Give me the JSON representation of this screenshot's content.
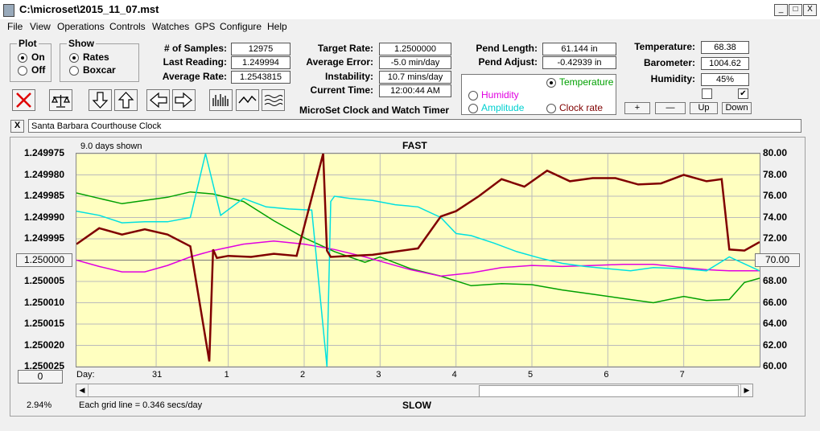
{
  "window": {
    "title": "C:\\microset\\2015_11_07.mst",
    "min": "_",
    "max": "□",
    "close": "X"
  },
  "menu": [
    "File",
    "View",
    "Operations",
    "Controls",
    "Watches",
    "GPS",
    "Configure",
    "Help"
  ],
  "plot": {
    "legend": "Plot",
    "on": "On",
    "off": "Off",
    "selected": "On"
  },
  "show": {
    "legend": "Show",
    "rates": "Rates",
    "boxcar": "Boxcar",
    "selected": "Rates"
  },
  "stats": {
    "samples_label": "# of Samples:",
    "samples": "12975",
    "last_label": "Last Reading:",
    "last": "1.249994",
    "avg_label": "Average Rate:",
    "avg": "1.2543815",
    "target_label": "Target Rate:",
    "target": "1.2500000",
    "avgerr_label": "Average Error:",
    "avgerr": "-5.0 min/day",
    "instab_label": "Instability:",
    "instab": "10.7 mins/day",
    "time_label": "Current Time:",
    "time": "12:00:44 AM",
    "pendlen_label": "Pend Length:",
    "pendlen": "61.144 in",
    "pendadj_label": "Pend Adjust:",
    "pendadj": "-0.42939 in",
    "temp_label": "Temperature:",
    "temp": "68.38",
    "baro_label": "Barometer:",
    "baro": "1004.62",
    "hum_label": "Humidity:",
    "hum": "45%"
  },
  "app_caption": "MicroSet Clock and Watch Timer",
  "overlay": {
    "temperature": "Temperature",
    "humidity": "Humidity",
    "amplitude": "Amplitude",
    "clockrate": "Clock rate",
    "selected": "Temperature",
    "temperature_color": "#00a000",
    "humidity_color": "#e000e0",
    "amplitude_color": "#00e0e0",
    "clockrate_color": "#800000"
  },
  "small_buttons": {
    "plus": "+",
    "minus": "—",
    "up": "Up",
    "down": "Down"
  },
  "checks": {
    "left": "",
    "right": "✔"
  },
  "clock_name": "Santa Barbara Courthouse Clock",
  "close_x": "X",
  "chart": {
    "days_shown": "9.0 days shown",
    "fast": "FAST",
    "slow": "SLOW",
    "center_left": "1.250000",
    "center_right": "70.00",
    "zero_button": "0",
    "day_label": "Day:",
    "percent": "2.94%",
    "grid_note": "Each grid line = 0.346 secs/day"
  },
  "chart_data": {
    "type": "line",
    "title": "FAST",
    "left_ticks": [
      "1.249975",
      "1.249980",
      "1.249985",
      "1.249990",
      "1.249995",
      "1.250000",
      "1.250005",
      "1.250010",
      "1.250015",
      "1.250020",
      "1.250025"
    ],
    "right_ticks": [
      "80.00",
      "78.00",
      "76.00",
      "74.00",
      "72.00",
      "70.00",
      "68.00",
      "66.00",
      "64.00",
      "62.00",
      "60.00"
    ],
    "x_ticks": [
      "31",
      "1",
      "2",
      "3",
      "4",
      "5",
      "6",
      "7"
    ],
    "x_tick_days": [
      1.05,
      2.0,
      3.0,
      4.0,
      5.0,
      6.0,
      7.0,
      8.0
    ],
    "xlim": [
      0,
      9
    ],
    "ylim_left": [
      1.249975,
      1.250025
    ],
    "ylim_right": [
      60,
      80
    ],
    "grid": true,
    "series": [
      {
        "name": "Temperature",
        "axis": "right",
        "color": "#00a000",
        "x": [
          0,
          0.3,
          0.6,
          0.9,
          1.2,
          1.5,
          1.8,
          2.2,
          2.6,
          3.0,
          3.4,
          3.8,
          4.0,
          4.4,
          4.8,
          5.2,
          5.6,
          6.0,
          6.4,
          6.8,
          7.2,
          7.6,
          8.0,
          8.3,
          8.6,
          8.8,
          9.0
        ],
        "y": [
          76.3,
          75.8,
          75.3,
          75.6,
          75.9,
          76.4,
          76.2,
          75.5,
          73.7,
          72.1,
          70.8,
          69.8,
          70.3,
          69.2,
          68.5,
          67.6,
          67.8,
          67.7,
          67.2,
          66.8,
          66.4,
          66.0,
          66.6,
          66.2,
          66.3,
          67.9,
          68.3
        ]
      },
      {
        "name": "Humidity",
        "axis": "right",
        "color": "#e000e0",
        "x": [
          0,
          0.3,
          0.6,
          0.9,
          1.2,
          1.5,
          1.8,
          2.2,
          2.6,
          3.0,
          3.4,
          3.8,
          4.0,
          4.4,
          4.8,
          5.2,
          5.6,
          6.0,
          6.4,
          6.8,
          7.2,
          7.6,
          8.0,
          8.3,
          8.6,
          9.0
        ],
        "y": [
          70.0,
          69.4,
          68.9,
          68.9,
          69.5,
          70.3,
          70.9,
          71.5,
          71.8,
          71.5,
          71.0,
          70.3,
          69.9,
          69.1,
          68.5,
          68.8,
          69.3,
          69.5,
          69.4,
          69.5,
          69.6,
          69.6,
          69.3,
          69.1,
          69.0,
          69.0
        ]
      },
      {
        "name": "Amplitude",
        "axis": "right",
        "color": "#00e0e0",
        "x": [
          0,
          0.3,
          0.6,
          0.9,
          1.2,
          1.5,
          1.7,
          1.9,
          2.2,
          2.5,
          2.8,
          3.1,
          3.3,
          3.35,
          3.4,
          3.6,
          3.9,
          4.2,
          4.5,
          4.8,
          5.0,
          5.2,
          5.5,
          5.8,
          6.1,
          6.4,
          6.7,
          7.0,
          7.3,
          7.6,
          8.0,
          8.3,
          8.6,
          9.0
        ],
        "y": [
          74.6,
          74.2,
          73.5,
          73.6,
          73.6,
          74.0,
          80.0,
          74.2,
          75.8,
          75.0,
          74.8,
          74.7,
          60.0,
          75.5,
          76.0,
          75.8,
          75.6,
          75.2,
          75.0,
          74.0,
          72.5,
          72.3,
          71.6,
          70.8,
          70.2,
          69.7,
          69.4,
          69.2,
          69.0,
          69.3,
          69.2,
          69.0,
          70.3,
          69.0
        ]
      },
      {
        "name": "Clock rate",
        "axis": "right",
        "color": "#800000",
        "x": [
          0,
          0.3,
          0.6,
          0.9,
          1.2,
          1.5,
          1.75,
          1.8,
          1.85,
          2.0,
          2.3,
          2.6,
          2.9,
          3.25,
          3.3,
          3.35,
          3.6,
          3.9,
          4.2,
          4.5,
          4.8,
          5.0,
          5.3,
          5.6,
          5.9,
          6.2,
          6.5,
          6.8,
          7.1,
          7.4,
          7.7,
          8.0,
          8.3,
          8.5,
          8.6,
          8.8,
          9.0
        ],
        "y": [
          71.5,
          73.0,
          72.4,
          72.9,
          72.4,
          71.3,
          60.5,
          71.0,
          70.2,
          70.4,
          70.3,
          70.6,
          70.4,
          80.0,
          70.9,
          70.3,
          70.4,
          70.5,
          70.8,
          71.1,
          74.1,
          74.6,
          76.0,
          77.6,
          76.9,
          78.4,
          77.4,
          77.7,
          77.7,
          77.1,
          77.2,
          78.0,
          77.4,
          77.6,
          71.0,
          70.9,
          71.7
        ]
      }
    ]
  }
}
